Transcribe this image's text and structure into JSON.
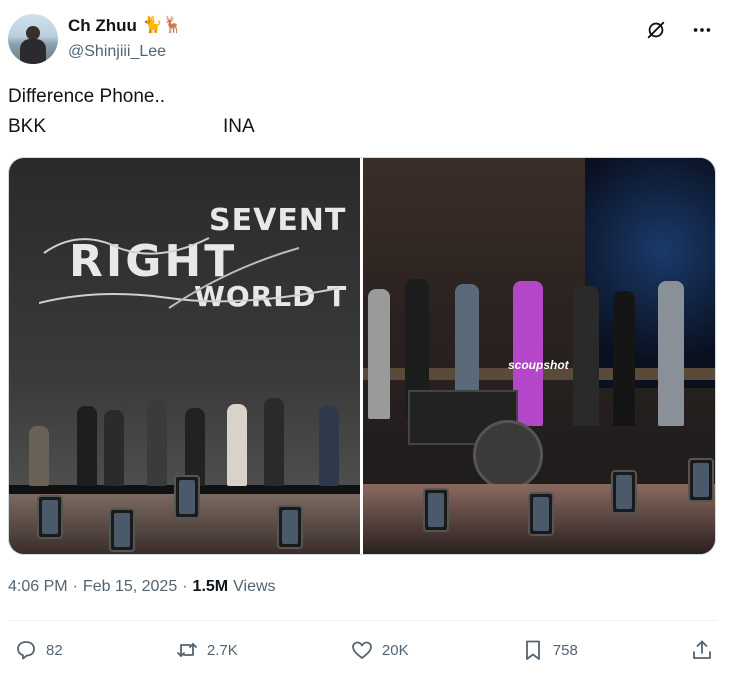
{
  "author": {
    "display_name": "Ch Zhuu",
    "emojis": "🐈🦌",
    "handle": "@Shinjiii_Lee"
  },
  "tweet": {
    "line1": "Difference Phone..",
    "label_left": "BKK",
    "label_right": "INA"
  },
  "media": {
    "left_screen": [
      "SEVENT",
      "RIGHT",
      "WORLD T"
    ],
    "right_watermark": "scoupshot"
  },
  "meta": {
    "time": "4:06 PM",
    "date": "Feb 15, 2025",
    "views_count": "1.5M",
    "views_label": "Views",
    "separator": "·"
  },
  "actions": {
    "replies": "82",
    "reposts": "2.7K",
    "likes": "20K",
    "bookmarks": "758"
  },
  "icons": [
    "grok-icon",
    "more-icon",
    "reply-icon",
    "repost-icon",
    "like-icon",
    "bookmark-icon",
    "share-icon"
  ],
  "colors": {
    "text_primary": "#0f1419",
    "text_secondary": "#536471",
    "border": "#cfd9de"
  }
}
